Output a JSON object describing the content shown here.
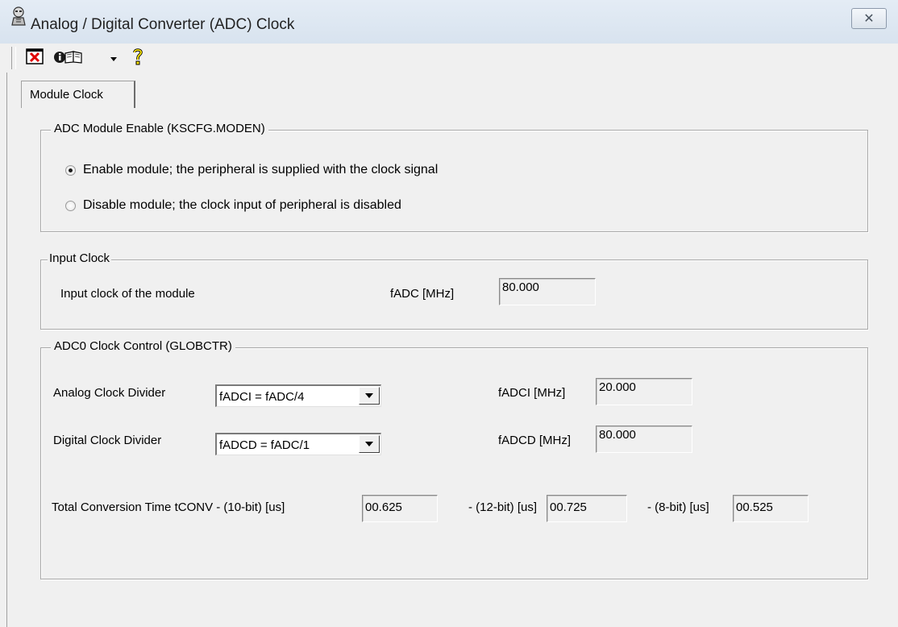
{
  "window": {
    "title": "Analog / Digital Converter (ADC) Clock",
    "close_glyph": "✕"
  },
  "toolbar": {
    "icons": [
      "close-document-icon",
      "info-book-icon",
      "dropdown-arrow-icon",
      "help-icon"
    ]
  },
  "tabs": [
    {
      "label": "Module Clock"
    }
  ],
  "module_enable": {
    "legend": "ADC Module Enable (KSCFG.MODEN)",
    "options": [
      {
        "label": "Enable module; the peripheral is supplied with the clock signal",
        "checked": true
      },
      {
        "label": "Disable module; the clock input of peripheral is disabled",
        "checked": false
      }
    ]
  },
  "input_clock": {
    "legend": "Input Clock",
    "description": "Input clock of the module",
    "field_label": "fADC [MHz]",
    "value": "80.000"
  },
  "clock_control": {
    "legend": "ADC0 Clock Control (GLOBCTR)",
    "analog_label": "Analog Clock Divider",
    "analog_selected": "fADCI = fADC/4",
    "analog_out_label": "fADCI [MHz]",
    "analog_out_value": "20.000",
    "digital_label": "Digital Clock Divider",
    "digital_selected": "fADCD = fADC/1",
    "digital_out_label": "fADCD [MHz]",
    "digital_out_value": "80.000",
    "tconv_label": "Total Conversion Time tCONV - (10-bit) [us]",
    "tconv_10": "00.625",
    "tconv_12_label": "- (12-bit) [us]",
    "tconv_12": "00.725",
    "tconv_8_label": "- (8-bit) [us]",
    "tconv_8": "00.525"
  }
}
